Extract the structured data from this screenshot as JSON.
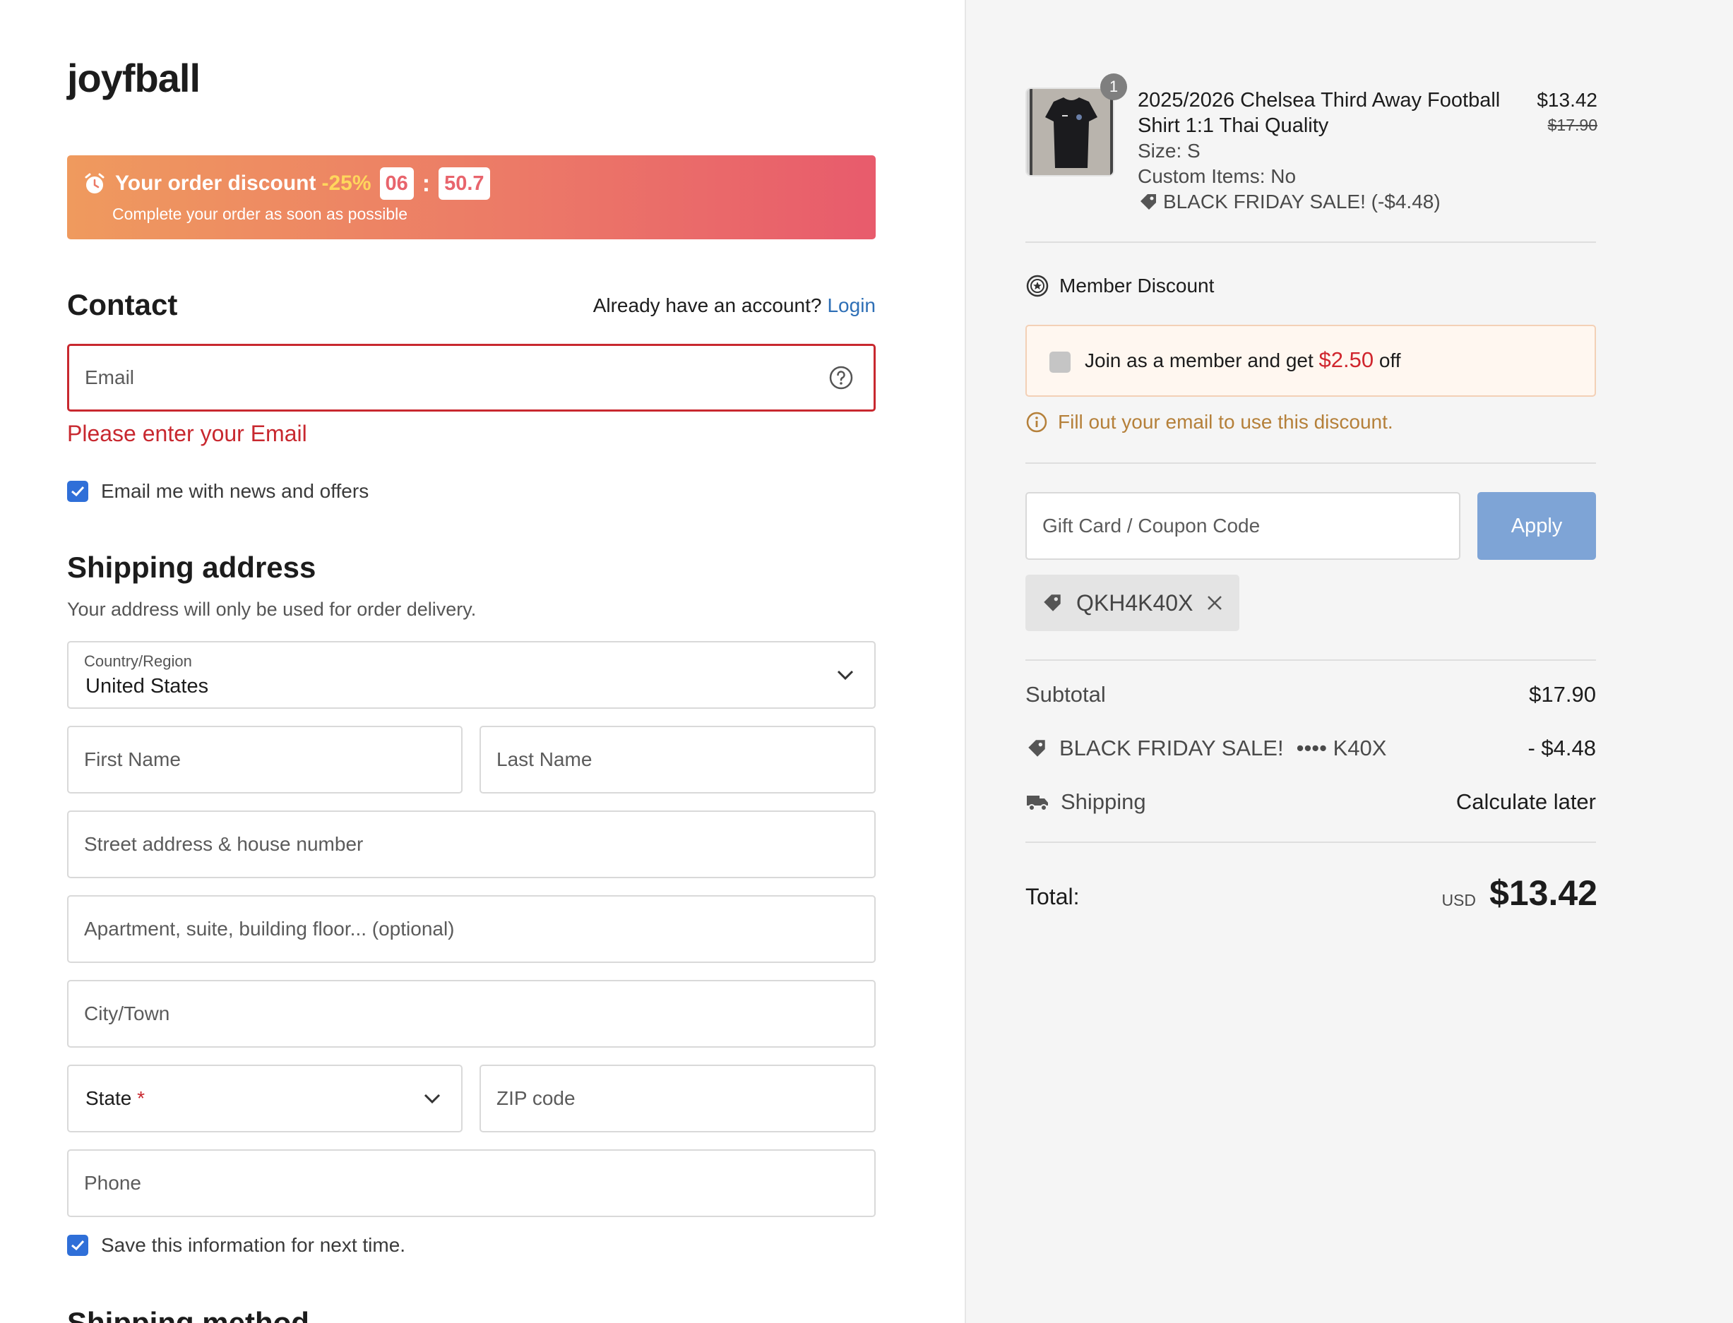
{
  "brand": "joyfball",
  "banner": {
    "title": "Your order discount",
    "percent": "-25%",
    "minutes": "06",
    "seconds": "50.7",
    "subtitle": "Complete your order as soon as possible"
  },
  "contact": {
    "heading": "Contact",
    "account_prompt": "Already have an account?",
    "login_label": "Login",
    "email_placeholder": "Email",
    "email_error": "Please enter your Email",
    "news_label": "Email me with news and offers"
  },
  "shipping": {
    "heading": "Shipping address",
    "note": "Your address will only be used for order delivery.",
    "country_label": "Country/Region",
    "country_value": "United States",
    "first_name": "First Name",
    "last_name": "Last Name",
    "street": "Street address & house number",
    "apartment": "Apartment, suite, building floor... (optional)",
    "city": "City/Town",
    "state": "State",
    "state_required": "*",
    "zip": "ZIP code",
    "phone": "Phone",
    "save_label": "Save this information for next time.",
    "next_heading": "Shipping method"
  },
  "product": {
    "quantity": "1",
    "name": "2025/2026 Chelsea Third Away Football Shirt 1:1 Thai Quality",
    "size": "Size: S",
    "custom": "Custom Items: No",
    "sale": "BLACK FRIDAY SALE! (-$4.48)",
    "price": "$13.42",
    "old_price": "$17.90"
  },
  "member": {
    "title": "Member Discount",
    "join_prefix": "Join as a member and get",
    "join_amount": "$2.50",
    "join_suffix": "off",
    "hint": "Fill out your email to use this discount."
  },
  "coupon": {
    "placeholder": "Gift Card / Coupon Code",
    "apply_label": "Apply",
    "applied_code": "QKH4K40X"
  },
  "summary": {
    "subtotal_label": "Subtotal",
    "subtotal_value": "$17.90",
    "discount_label": "BLACK FRIDAY SALE!",
    "discount_code": "•••• K40X",
    "discount_value": "- $4.48",
    "shipping_label": "Shipping",
    "shipping_value": "Calculate later",
    "total_label": "Total:",
    "currency": "USD",
    "total_value": "$13.42"
  },
  "colors": {
    "error": "#c8282f",
    "link": "#2e6fb6",
    "checkbox": "#2f6fd8",
    "apply_button": "#7ea4d6",
    "member_amount": "#d0262e",
    "hint": "#b5803a"
  }
}
